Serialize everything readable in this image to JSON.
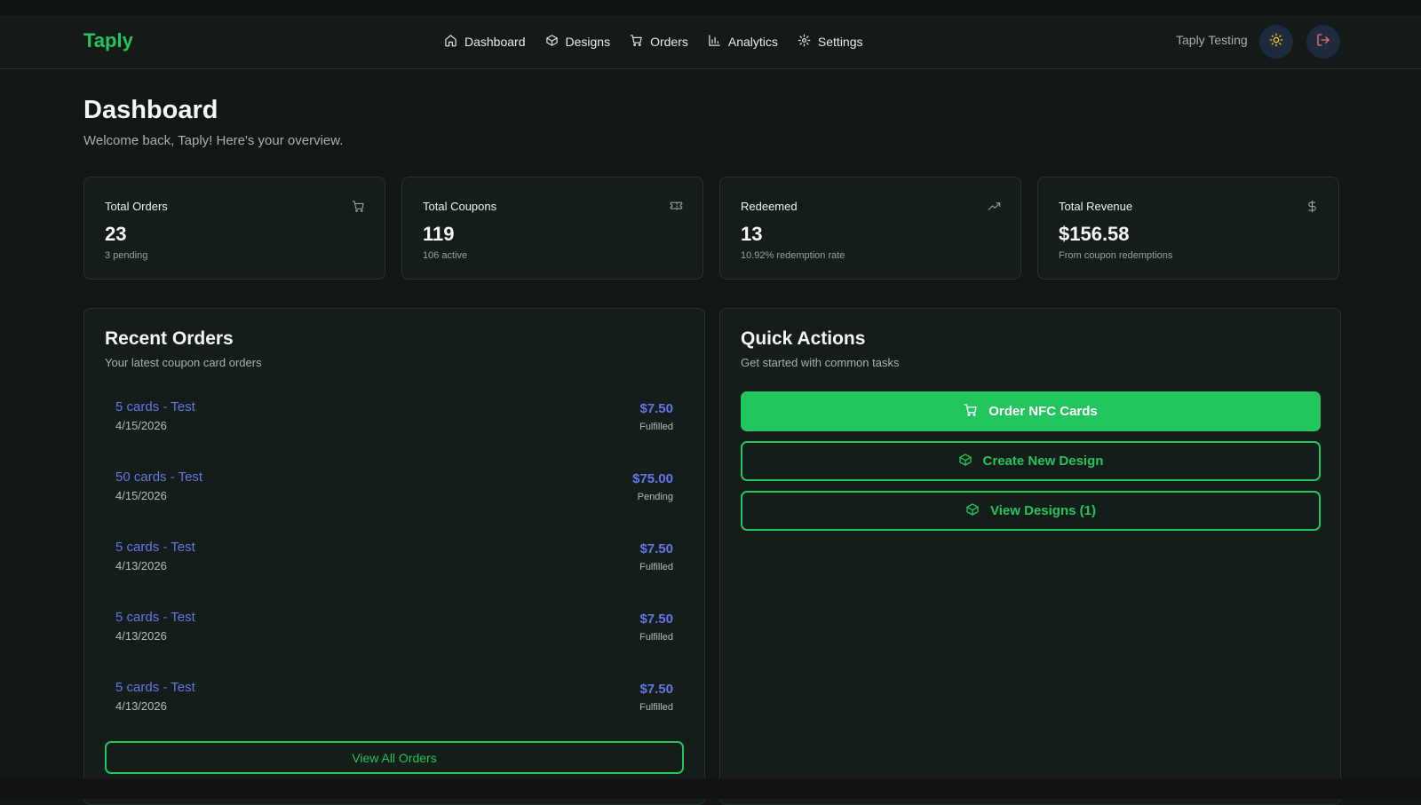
{
  "header": {
    "logo": "Taply",
    "nav": [
      {
        "label": "Dashboard",
        "icon": "home-icon"
      },
      {
        "label": "Designs",
        "icon": "box-icon"
      },
      {
        "label": "Orders",
        "icon": "cart-icon"
      },
      {
        "label": "Analytics",
        "icon": "bar-chart-icon"
      },
      {
        "label": "Settings",
        "icon": "gear-icon"
      }
    ],
    "user_name": "Taply Testing",
    "theme_icon": "sun-icon",
    "logout_icon": "logout-icon"
  },
  "page": {
    "title": "Dashboard",
    "subtitle": "Welcome back, Taply! Here's your overview."
  },
  "stats": [
    {
      "label": "Total Orders",
      "value": "23",
      "note": "3 pending",
      "icon": "cart-icon"
    },
    {
      "label": "Total Coupons",
      "value": "119",
      "note": "106 active",
      "icon": "ticket-icon"
    },
    {
      "label": "Redeemed",
      "value": "13",
      "note": "10.92% redemption rate",
      "icon": "trending-up-icon"
    },
    {
      "label": "Total Revenue",
      "value": "$156.58",
      "note": "From coupon redemptions",
      "icon": "dollar-icon"
    }
  ],
  "recent_orders": {
    "title": "Recent Orders",
    "subtitle": "Your latest coupon card orders",
    "orders": [
      {
        "name": "5 cards - Test",
        "date": "4/15/2026",
        "amount": "$7.50",
        "status": "Fulfilled"
      },
      {
        "name": "50 cards - Test",
        "date": "4/15/2026",
        "amount": "$75.00",
        "status": "Pending"
      },
      {
        "name": "5 cards - Test",
        "date": "4/13/2026",
        "amount": "$7.50",
        "status": "Fulfilled"
      },
      {
        "name": "5 cards - Test",
        "date": "4/13/2026",
        "amount": "$7.50",
        "status": "Fulfilled"
      },
      {
        "name": "5 cards - Test",
        "date": "4/13/2026",
        "amount": "$7.50",
        "status": "Fulfilled"
      }
    ],
    "view_all_label": "View All Orders"
  },
  "quick_actions": {
    "title": "Quick Actions",
    "subtitle": "Get started with common tasks",
    "actions": [
      {
        "label": "Order NFC Cards",
        "icon": "cart-icon"
      },
      {
        "label": "Create New Design",
        "icon": "box-icon"
      },
      {
        "label": "View Designs (1)",
        "icon": "box-icon"
      }
    ]
  },
  "colors": {
    "accent": "#22c55e",
    "link": "#6675e8",
    "background": "#121614",
    "card": "#141d19"
  }
}
